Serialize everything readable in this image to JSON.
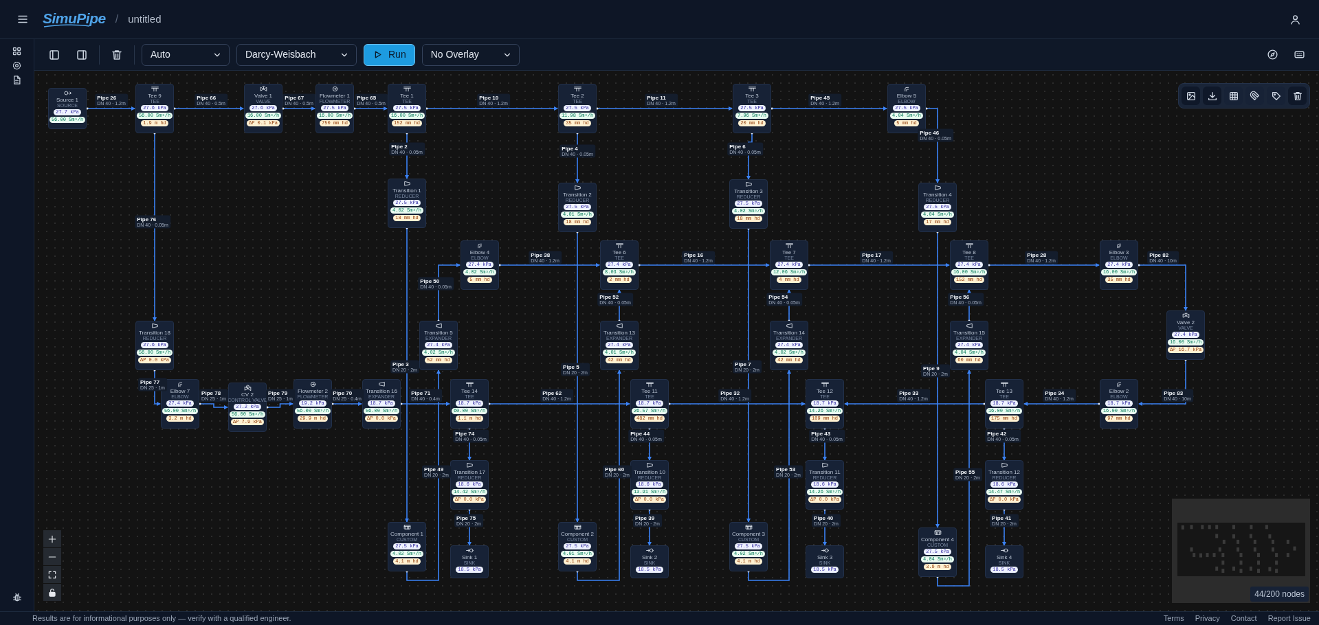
{
  "header": {
    "logo": "SimuPipe",
    "separator": "/",
    "project": "untitled"
  },
  "toolbar": {
    "selects": [
      {
        "value": "Auto"
      },
      {
        "value": "Darcy-Weisbach"
      }
    ],
    "run_button": "Run",
    "overlay_select": {
      "value": "No Overlay"
    }
  },
  "nodes": [
    {
      "name": "Source 1",
      "type": "SOURCE",
      "kind": "source",
      "readings": [
        {
          "kind": "pressure",
          "text": "27.7 kPa"
        },
        {
          "kind": "flow",
          "text": "56.00 Sm³/h"
        }
      ]
    },
    {
      "name": "Tee 9",
      "type": "TEE",
      "kind": "tee",
      "readings": [
        {
          "kind": "pressure",
          "text": "27.6 kPa"
        },
        {
          "kind": "flow",
          "text": "56.00 Sm³/h"
        },
        {
          "kind": "loss",
          "text": "1.9 m hd"
        }
      ]
    },
    {
      "name": "Valve 1",
      "type": "VALVE",
      "kind": "valve",
      "readings": [
        {
          "kind": "pressure",
          "text": "27.6 kPa"
        },
        {
          "kind": "flow",
          "text": "16.00 Sm³/h"
        },
        {
          "kind": "loss",
          "text": "ΔP 0.1 kPa"
        }
      ]
    },
    {
      "name": "Flowmeter 1",
      "type": "FLOWMETER",
      "kind": "flowmeter",
      "readings": [
        {
          "kind": "pressure",
          "text": "27.5 kPa"
        },
        {
          "kind": "flow",
          "text": "16.00 Sm³/h"
        },
        {
          "kind": "loss",
          "text": "750 mm hd"
        }
      ]
    },
    {
      "name": "Tee 1",
      "type": "TEE",
      "kind": "tee",
      "readings": [
        {
          "kind": "pressure",
          "text": "27.5 kPa"
        },
        {
          "kind": "flow",
          "text": "16.00 Sm³/h"
        },
        {
          "kind": "loss",
          "text": "152 mm hd"
        }
      ]
    },
    {
      "name": "Tee 2",
      "type": "TEE",
      "kind": "tee",
      "readings": [
        {
          "kind": "pressure",
          "text": "27.5 kPa"
        },
        {
          "kind": "flow",
          "text": "11.98 Sm³/h"
        },
        {
          "kind": "loss",
          "text": "35 mm hd"
        }
      ]
    },
    {
      "name": "Tee 3",
      "type": "TEE",
      "kind": "tee",
      "readings": [
        {
          "kind": "pressure",
          "text": "27.5 kPa"
        },
        {
          "kind": "flow",
          "text": "7.96 Sm³/h"
        },
        {
          "kind": "loss",
          "text": "20 mm hd"
        }
      ]
    },
    {
      "name": "Elbow 5",
      "type": "ELBOW",
      "kind": "elbow",
      "readings": [
        {
          "kind": "pressure",
          "text": "27.5 kPa"
        },
        {
          "kind": "flow",
          "text": "4.04 Sm³/h"
        },
        {
          "kind": "loss",
          "text": "5 mm hd"
        }
      ]
    },
    {
      "name": "Transition 1",
      "type": "REDUCER",
      "kind": "reducer",
      "readings": [
        {
          "kind": "pressure",
          "text": "27.5 kPa"
        },
        {
          "kind": "flow",
          "text": "4.02 Sm³/h"
        },
        {
          "kind": "loss",
          "text": "18 mm hd"
        }
      ]
    },
    {
      "name": "Transition 2",
      "type": "REDUCER",
      "kind": "reducer",
      "readings": [
        {
          "kind": "pressure",
          "text": "27.5 kPa"
        },
        {
          "kind": "flow",
          "text": "4.01 Sm³/h"
        },
        {
          "kind": "loss",
          "text": "18 mm hd"
        }
      ]
    },
    {
      "name": "Transition 3",
      "type": "REDUCER",
      "kind": "reducer",
      "readings": [
        {
          "kind": "pressure",
          "text": "27.5 kPa"
        },
        {
          "kind": "flow",
          "text": "4.02 Sm³/h"
        },
        {
          "kind": "loss",
          "text": "18 mm hd"
        }
      ]
    },
    {
      "name": "Transition 4",
      "type": "REDUCER",
      "kind": "reducer",
      "readings": [
        {
          "kind": "pressure",
          "text": "27.5 kPa"
        },
        {
          "kind": "flow",
          "text": "4.04 Sm³/h"
        },
        {
          "kind": "loss",
          "text": "17 mm hd"
        }
      ]
    },
    {
      "name": "Elbow 4",
      "type": "ELBOW",
      "kind": "elbow",
      "readings": [
        {
          "kind": "pressure",
          "text": "27.4 kPa"
        },
        {
          "kind": "flow",
          "text": "4.02 Sm³/h"
        },
        {
          "kind": "loss",
          "text": "5 mm hd"
        }
      ]
    },
    {
      "name": "Tee 6",
      "type": "TEE",
      "kind": "tee",
      "readings": [
        {
          "kind": "pressure",
          "text": "27.4 kPa"
        },
        {
          "kind": "flow",
          "text": "8.03 Sm³/h"
        },
        {
          "kind": "loss",
          "text": "2 mm hd"
        }
      ]
    },
    {
      "name": "Tee 7",
      "type": "TEE",
      "kind": "tee",
      "readings": [
        {
          "kind": "pressure",
          "text": "27.4 kPa"
        },
        {
          "kind": "flow",
          "text": "12.06 Sm³/h"
        },
        {
          "kind": "loss",
          "text": "4 mm hd"
        }
      ]
    },
    {
      "name": "Tee 8",
      "type": "TEE",
      "kind": "tee",
      "readings": [
        {
          "kind": "pressure",
          "text": "27.4 kPa"
        },
        {
          "kind": "flow",
          "text": "16.00 Sm³/h"
        },
        {
          "kind": "loss",
          "text": "152 mm hd"
        }
      ]
    },
    {
      "name": "Elbow 3",
      "type": "ELBOW",
      "kind": "elbow",
      "readings": [
        {
          "kind": "pressure",
          "text": "27.4 kPa"
        },
        {
          "kind": "flow",
          "text": "16.00 Sm³/h"
        },
        {
          "kind": "loss",
          "text": "35 mm hd"
        }
      ]
    },
    {
      "name": "Transition 18",
      "type": "REDUCER",
      "kind": "reducer",
      "readings": [
        {
          "kind": "pressure",
          "text": "27.6 kPa"
        },
        {
          "kind": "flow",
          "text": "56.00 Sm³/h"
        },
        {
          "kind": "loss",
          "text": "ΔP 0.0 kPa"
        }
      ]
    },
    {
      "name": "Transition 5",
      "type": "EXPANDER",
      "kind": "expander",
      "readings": [
        {
          "kind": "pressure",
          "text": "27.4 kPa"
        },
        {
          "kind": "flow",
          "text": "4.02 Sm³/h"
        },
        {
          "kind": "loss",
          "text": "52 mm hd"
        }
      ]
    },
    {
      "name": "Transition 13",
      "type": "EXPANDER",
      "kind": "expander",
      "readings": [
        {
          "kind": "pressure",
          "text": "27.4 kPa"
        },
        {
          "kind": "flow",
          "text": "4.01 Sm³/h"
        },
        {
          "kind": "loss",
          "text": "42 mm hd"
        }
      ]
    },
    {
      "name": "Transition 14",
      "type": "EXPANDER",
      "kind": "expander",
      "readings": [
        {
          "kind": "pressure",
          "text": "27.4 kPa"
        },
        {
          "kind": "flow",
          "text": "4.02 Sm³/h"
        },
        {
          "kind": "loss",
          "text": "42 mm hd"
        }
      ]
    },
    {
      "name": "Transition 15",
      "type": "EXPANDER",
      "kind": "expander",
      "readings": [
        {
          "kind": "pressure",
          "text": "27.4 kPa"
        },
        {
          "kind": "flow",
          "text": "4.04 Sm³/h"
        },
        {
          "kind": "loss",
          "text": "60 mm hd"
        }
      ]
    },
    {
      "name": "Valve 2",
      "type": "VALVE",
      "kind": "valve",
      "readings": [
        {
          "kind": "pressure",
          "text": "27.4 kPa"
        },
        {
          "kind": "flow",
          "text": "16.00 Sm³/h"
        },
        {
          "kind": "loss",
          "text": "ΔP 16.7 kPa"
        }
      ]
    },
    {
      "name": "Elbow 7",
      "type": "ELBOW",
      "kind": "elbow",
      "readings": [
        {
          "kind": "pressure",
          "text": "27.4 kPa"
        },
        {
          "kind": "flow",
          "text": "56.00 Sm³/h"
        },
        {
          "kind": "loss",
          "text": "3.2 m hd"
        }
      ]
    },
    {
      "name": "CV 2",
      "type": "CONTROL VALVE",
      "kind": "control_valve",
      "readings": [
        {
          "kind": "pressure",
          "text": "27.2 kPa"
        },
        {
          "kind": "flow",
          "text": "56.00 Sm³/h"
        },
        {
          "kind": "loss",
          "text": "ΔP 7.9 kPa"
        }
      ]
    },
    {
      "name": "Flowmeter 2",
      "type": "FLOWMETER",
      "kind": "flowmeter",
      "readings": [
        {
          "kind": "pressure",
          "text": "19.2 kPa"
        },
        {
          "kind": "flow",
          "text": "56.00 Sm³/h"
        },
        {
          "kind": "loss",
          "text": "29.9 m hd"
        }
      ]
    },
    {
      "name": "Transition 16",
      "type": "EXPANDER",
      "kind": "expander",
      "readings": [
        {
          "kind": "pressure",
          "text": "18.7 kPa"
        },
        {
          "kind": "flow",
          "text": "56.00 Sm³/h"
        },
        {
          "kind": "loss",
          "text": "ΔP 0.0 kPa"
        }
      ]
    },
    {
      "name": "Tee 14",
      "type": "TEE",
      "kind": "tee",
      "readings": [
        {
          "kind": "pressure",
          "text": "18.7 kPa"
        },
        {
          "kind": "flow",
          "text": "60.00 Sm³/h"
        },
        {
          "kind": "loss",
          "text": "1.1 m hd"
        }
      ]
    },
    {
      "name": "Tee 11",
      "type": "TEE",
      "kind": "tee",
      "readings": [
        {
          "kind": "pressure",
          "text": "18.7 kPa"
        },
        {
          "kind": "flow",
          "text": "26.57 Sm³/h"
        },
        {
          "kind": "loss",
          "text": "482 mm hd"
        }
      ]
    },
    {
      "name": "Tee 12",
      "type": "TEE",
      "kind": "tee",
      "readings": [
        {
          "kind": "pressure",
          "text": "18.7 kPa"
        },
        {
          "kind": "flow",
          "text": "14.26 Sm³/h"
        },
        {
          "kind": "loss",
          "text": "109 mm hd"
        }
      ]
    },
    {
      "name": "Tee 13",
      "type": "TEE",
      "kind": "tee",
      "readings": [
        {
          "kind": "pressure",
          "text": "18.7 kPa"
        },
        {
          "kind": "flow",
          "text": "16.00 Sm³/h"
        },
        {
          "kind": "loss",
          "text": "175 mm hd"
        }
      ]
    },
    {
      "name": "Elbow 2",
      "type": "ELBOW",
      "kind": "elbow",
      "readings": [
        {
          "kind": "pressure",
          "text": "18.7 kPa"
        },
        {
          "kind": "flow",
          "text": "16.00 Sm³/h"
        },
        {
          "kind": "loss",
          "text": "97 mm hd"
        }
      ]
    },
    {
      "name": "Transition 17",
      "type": "REDUCER",
      "kind": "reducer",
      "readings": [
        {
          "kind": "pressure",
          "text": "18.6 kPa"
        },
        {
          "kind": "flow",
          "text": "14.42 Sm³/h"
        },
        {
          "kind": "loss",
          "text": "ΔP 0.0 kPa"
        }
      ]
    },
    {
      "name": "Transition 10",
      "type": "REDUCER",
      "kind": "reducer",
      "readings": [
        {
          "kind": "pressure",
          "text": "18.6 kPa"
        },
        {
          "kind": "flow",
          "text": "13.91 Sm³/h"
        },
        {
          "kind": "loss",
          "text": "ΔP 0.0 kPa"
        }
      ]
    },
    {
      "name": "Transition 11",
      "type": "REDUCER",
      "kind": "reducer",
      "readings": [
        {
          "kind": "pressure",
          "text": "18.6 kPa"
        },
        {
          "kind": "flow",
          "text": "14.26 Sm³/h"
        },
        {
          "kind": "loss",
          "text": "ΔP 0.0 kPa"
        }
      ]
    },
    {
      "name": "Transition 12",
      "type": "REDUCER",
      "kind": "reducer",
      "readings": [
        {
          "kind": "pressure",
          "text": "18.6 kPa"
        },
        {
          "kind": "flow",
          "text": "14.47 Sm³/h"
        },
        {
          "kind": "loss",
          "text": "ΔP 0.0 kPa"
        }
      ]
    },
    {
      "name": "Component 1",
      "type": "CUSTOM",
      "kind": "custom",
      "readings": [
        {
          "kind": "pressure",
          "text": "27.5 kPa"
        },
        {
          "kind": "flow",
          "text": "4.02 Sm³/h"
        },
        {
          "kind": "loss",
          "text": "4.1 m hd"
        }
      ]
    },
    {
      "name": "Component 2",
      "type": "CUSTOM",
      "kind": "custom",
      "readings": [
        {
          "kind": "pressure",
          "text": "27.5 kPa"
        },
        {
          "kind": "flow",
          "text": "4.01 Sm³/h"
        },
        {
          "kind": "loss",
          "text": "4.1 m hd"
        }
      ]
    },
    {
      "name": "Component 3",
      "type": "CUSTOM",
      "kind": "custom",
      "readings": [
        {
          "kind": "pressure",
          "text": "27.5 kPa"
        },
        {
          "kind": "flow",
          "text": "4.02 Sm³/h"
        },
        {
          "kind": "loss",
          "text": "4.1 m hd"
        }
      ]
    },
    {
      "name": "Component 4",
      "type": "CUSTOM",
      "kind": "custom",
      "readings": [
        {
          "kind": "pressure",
          "text": "27.5 kPa"
        },
        {
          "kind": "flow",
          "text": "4.04 Sm³/h"
        },
        {
          "kind": "loss",
          "text": "3.9 m hd"
        }
      ]
    },
    {
      "name": "Sink 1",
      "type": "SINK",
      "kind": "sink",
      "readings": [
        {
          "kind": "pressure",
          "text": "18.5 kPa"
        }
      ]
    },
    {
      "name": "Sink 2",
      "type": "SINK",
      "kind": "sink",
      "readings": [
        {
          "kind": "pressure",
          "text": "18.5 kPa"
        }
      ]
    },
    {
      "name": "Sink 3",
      "type": "SINK",
      "kind": "sink",
      "readings": [
        {
          "kind": "pressure",
          "text": "18.5 kPa"
        }
      ]
    },
    {
      "name": "Sink 4",
      "type": "SINK",
      "kind": "sink",
      "readings": [
        {
          "kind": "pressure",
          "text": "18.5 kPa"
        }
      ]
    }
  ],
  "pipes": [
    {
      "name": "Pipe 26",
      "spec": "DN 40 · 1.2m"
    },
    {
      "name": "Pipe 66",
      "spec": "DN 40 · 0.5m"
    },
    {
      "name": "Pipe 67",
      "spec": "DN 40 · 0.5m"
    },
    {
      "name": "Pipe 65",
      "spec": "DN 40 · 0.5m"
    },
    {
      "name": "Pipe 10",
      "spec": "DN 40 · 1.2m"
    },
    {
      "name": "Pipe 11",
      "spec": "DN 40 · 1.2m"
    },
    {
      "name": "Pipe 45",
      "spec": "DN 40 · 1.2m"
    },
    {
      "name": "Pipe 2",
      "spec": "DN 40 · 0.05m"
    },
    {
      "name": "Pipe 4",
      "spec": "DN 40 · 0.05m"
    },
    {
      "name": "Pipe 6",
      "spec": "DN 40 · 0.05m"
    },
    {
      "name": "Pipe 46",
      "spec": "DN 40 · 0.05m"
    },
    {
      "name": "Pipe 76",
      "spec": "DN 40 · 0.05m"
    },
    {
      "name": "Pipe 50",
      "spec": "DN 40 · 0.05m"
    },
    {
      "name": "Pipe 38",
      "spec": "DN 40 · 1.2m"
    },
    {
      "name": "Pipe 16",
      "spec": "DN 40 · 1.2m"
    },
    {
      "name": "Pipe 17",
      "spec": "DN 40 · 1.2m"
    },
    {
      "name": "Pipe 28",
      "spec": "DN 40 · 1.2m"
    },
    {
      "name": "Pipe 82",
      "spec": "DN 40 · 10m"
    },
    {
      "name": "Pipe 52",
      "spec": "DN 40 · 0.05m"
    },
    {
      "name": "Pipe 54",
      "spec": "DN 40 · 0.05m"
    },
    {
      "name": "Pipe 56",
      "spec": "DN 40 · 0.05m"
    },
    {
      "name": "Pipe 77",
      "spec": "DN 25 · 1m"
    },
    {
      "name": "Pipe 78",
      "spec": "DN 25 · 1m"
    },
    {
      "name": "Pipe 79",
      "spec": "DN 25 · 1m"
    },
    {
      "name": "Pipe 70",
      "spec": "DN 25 · 0.4m"
    },
    {
      "name": "Pipe 71",
      "spec": "DN 40 · 0.4m"
    },
    {
      "name": "Pipe 62",
      "spec": "DN 40 · 1.2m"
    },
    {
      "name": "Pipe 32",
      "spec": "DN 40 · 1.2m"
    },
    {
      "name": "Pipe 33",
      "spec": "DN 40 · 1.2m"
    },
    {
      "name": "Pipe 34",
      "spec": "DN 40 · 1.2m"
    },
    {
      "name": "Pipe 83",
      "spec": "DN 40 · 10m"
    },
    {
      "name": "Pipe 3",
      "spec": "DN 20 · 2m"
    },
    {
      "name": "Pipe 5",
      "spec": "DN 20 · 2m"
    },
    {
      "name": "Pipe 7",
      "spec": "DN 20 · 2m"
    },
    {
      "name": "Pipe 9",
      "spec": "DN 20 · 2m"
    },
    {
      "name": "Pipe 49",
      "spec": "DN 20 · 2m"
    },
    {
      "name": "Pipe 60",
      "spec": "DN 20 · 2m"
    },
    {
      "name": "Pipe 53",
      "spec": "DN 20 · 2m"
    },
    {
      "name": "Pipe 55",
      "spec": "DN 20 · 2m"
    },
    {
      "name": "Pipe 74",
      "spec": "DN 40 · 0.05m"
    },
    {
      "name": "Pipe 44",
      "spec": "DN 40 · 0.05m"
    },
    {
      "name": "Pipe 43",
      "spec": "DN 40 · 0.05m"
    },
    {
      "name": "Pipe 42",
      "spec": "DN 40 · 0.05m"
    },
    {
      "name": "Pipe 75",
      "spec": "DN 20 · 2m"
    },
    {
      "name": "Pipe 39",
      "spec": "DN 20 · 2m"
    },
    {
      "name": "Pipe 40",
      "spec": "DN 20 · 2m"
    },
    {
      "name": "Pipe 41",
      "spec": "DN 20 · 2m"
    }
  ],
  "minimap": {
    "node_count": "44/200 nodes"
  },
  "footer": {
    "disclaimer": "Results are for informational purposes only — verify with a qualified engineer.",
    "links": [
      "Terms",
      "Privacy",
      "Contact",
      "Report Issue"
    ]
  }
}
